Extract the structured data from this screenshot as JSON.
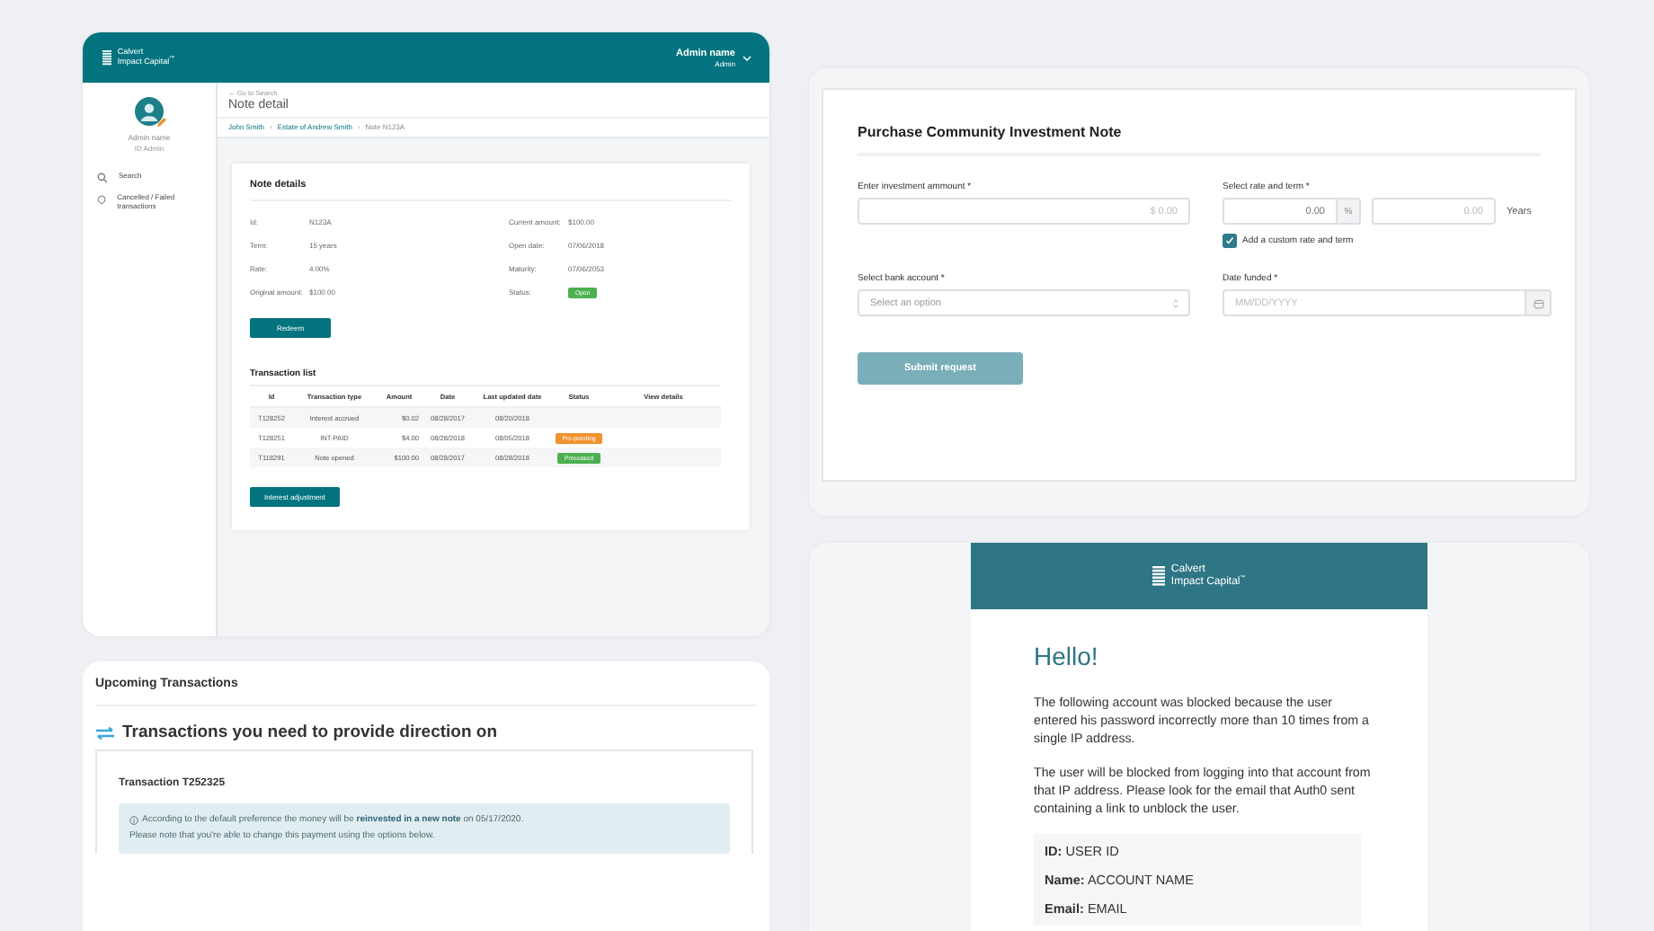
{
  "admin_app": {
    "header": {
      "brand": [
        "Calvert",
        "Impact Capital$^{™}$"
      ],
      "user_name": "Admin name",
      "user_role": "Admin"
    },
    "sidebar": {
      "profile_name": "Admin name",
      "profile_id": "ID Admin",
      "items": [
        {
          "label": "Search",
          "kind": "search"
        },
        {
          "label": "Cancelled / Failed transactions",
          "kind": "alert"
        }
      ]
    },
    "back_link": "← Go to Search",
    "page_title": "Note detail",
    "breadcrumbs": {
      "separator": "›",
      "items": [
        {
          "label": "John Smith",
          "link": true
        },
        {
          "label": "Estate of Andrew Smith",
          "link": true
        },
        {
          "label": "Note N123A",
          "link": false
        }
      ]
    },
    "note_details": {
      "title": "Note details",
      "left": [
        {
          "label": "Id:",
          "value": "N123A"
        },
        {
          "label": "Term:",
          "value": "15 years"
        },
        {
          "label": "Rate:",
          "value": "4.00%"
        },
        {
          "label": "Original amount:",
          "value": "$100.00"
        }
      ],
      "right": [
        {
          "label": "Current amount:",
          "value": "$100.00"
        },
        {
          "label": "Open date:",
          "value": "07/06/2018"
        },
        {
          "label": "Maturity:",
          "value": "07/06/2053"
        },
        {
          "label": "Status:",
          "value": "Open",
          "kind": "badge",
          "color": "#4caf50"
        }
      ]
    },
    "redeem_button": "Redeem",
    "transactions": {
      "title": "Transaction list",
      "columns": [
        "Id",
        "Transaction type",
        "Amount",
        "Date",
        "Last updated date",
        "Status",
        "View details"
      ],
      "rows": [
        {
          "id": "T128252",
          "type": "Interest accrued",
          "amount": "$0.02",
          "date": "08/28/2017",
          "updated": "08/20/2018"
        },
        {
          "id": "T128251",
          "type": "INT-PAID",
          "amount": "$4.00",
          "date": "08/28/2018",
          "updated": "08/05/2018",
          "status": {
            "label": "Pre-pending",
            "color": "#f0922e"
          }
        },
        {
          "id": "T118291",
          "type": "Note opened",
          "amount": "$100.00",
          "date": "08/28/2017",
          "updated": "08/28/2018",
          "status": {
            "label": "Processed",
            "color": "#4caf50"
          }
        }
      ]
    },
    "adjust_button": "Interest adjustment"
  },
  "purchase_form": {
    "title": "Purchase Community Investment Note",
    "amount": {
      "label": "Enter investment ammount *",
      "placeholder": "$ 0.00"
    },
    "rate_term": {
      "label": "Select rate and term *",
      "rate_value": "0.00",
      "rate_unit": "%",
      "term_placeholder": "0.00",
      "term_unit": "Years"
    },
    "custom_checkbox": {
      "label": "Add a custom rate and term",
      "checked": true
    },
    "bank_account": {
      "label": "Select bank account *",
      "placeholder": "Select an option"
    },
    "date_funded": {
      "label": "Date funded *",
      "placeholder": "MM/DD/YYYY"
    },
    "submit": {
      "label": "Submit request",
      "disabled": true
    }
  },
  "upcoming": {
    "title": "Upcoming Transactions",
    "section_heading": "Transactions you need to provide direction on",
    "transaction": {
      "title": "Transaction T252325",
      "notice": [
        "According to the default preference the money will be **reinvested in a new note** on 05/17/2020.",
        "Please note that you're able to change this payment using the options below."
      ]
    }
  },
  "email": {
    "brand": [
      "Calvert",
      "Impact Capital$^{™}$"
    ],
    "greeting": "Hello!",
    "paragraphs": [
      "The following account was blocked because the user entered his password incorrectly more than 10 times from a single IP address.",
      "The user will be blocked from logging into that account from that IP address. Please look for the email that Auth0 sent containing a link to unblock the user."
    ],
    "details": [
      {
        "label": "ID:",
        "value": "USER ID"
      },
      {
        "label": "Name:",
        "value": "ACCOUNT NAME"
      },
      {
        "label": "Email:",
        "value": "EMAIL"
      }
    ]
  }
}
